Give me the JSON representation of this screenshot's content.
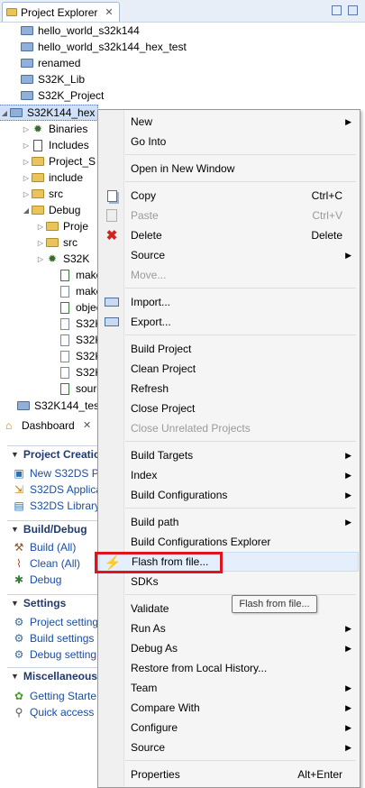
{
  "project_explorer": {
    "tab_title": "Project Explorer",
    "tree": [
      {
        "label": "hello_world_s32k144",
        "kind": "project",
        "arrow": ""
      },
      {
        "label": "hello_world_s32k144_hex_test",
        "kind": "project",
        "arrow": ""
      },
      {
        "label": "renamed",
        "kind": "project",
        "arrow": ""
      },
      {
        "label": "S32K_Lib",
        "kind": "project",
        "arrow": ""
      },
      {
        "label": "S32K_Project",
        "kind": "project",
        "arrow": ""
      },
      {
        "label": "S32K144_hex",
        "kind": "project-open",
        "arrow": "◢"
      },
      {
        "label": "Binaries",
        "kind": "gear",
        "arrow": "▷"
      },
      {
        "label": "Includes",
        "kind": "includes",
        "arrow": "▷"
      },
      {
        "label": "Project_S",
        "kind": "folder",
        "arrow": "▷"
      },
      {
        "label": "include",
        "kind": "folder",
        "arrow": "▷"
      },
      {
        "label": "src",
        "kind": "folder",
        "arrow": "▷"
      },
      {
        "label": "Debug",
        "kind": "folder",
        "arrow": "◢"
      },
      {
        "label": "Proje",
        "kind": "folder",
        "arrow": "▷"
      },
      {
        "label": "src",
        "kind": "folder",
        "arrow": "▷"
      },
      {
        "label": "S32K",
        "kind": "gear",
        "arrow": "▷"
      },
      {
        "label": "make",
        "kind": "file-gear",
        "arrow": ""
      },
      {
        "label": "make",
        "kind": "file",
        "arrow": ""
      },
      {
        "label": "objec",
        "kind": "file-gear",
        "arrow": ""
      },
      {
        "label": "S32K",
        "kind": "file",
        "arrow": ""
      },
      {
        "label": "S32K",
        "kind": "file",
        "arrow": ""
      },
      {
        "label": "S32K",
        "kind": "file",
        "arrow": ""
      },
      {
        "label": "S32K",
        "kind": "file",
        "arrow": ""
      },
      {
        "label": "sourc",
        "kind": "file-gear",
        "arrow": ""
      },
      {
        "label": "S32K144_tes",
        "kind": "project",
        "arrow": ""
      }
    ]
  },
  "dashboard": {
    "tab_title": "Dashboard",
    "sections": [
      {
        "title": "Project Creatio",
        "links": [
          {
            "label": "New S32DS Pr",
            "icon": "new-project-icon"
          },
          {
            "label": "S32DS Applica",
            "icon": "import-icon"
          },
          {
            "label": "S32DS Library",
            "icon": "library-icon"
          }
        ]
      },
      {
        "title": "Build/Debug",
        "links": [
          {
            "label": "Build  (All)",
            "icon": "hammer-icon"
          },
          {
            "label": "Clean  (All)",
            "icon": "broom-icon"
          },
          {
            "label": "Debug",
            "icon": "bug-icon"
          }
        ]
      },
      {
        "title": "Settings",
        "links": [
          {
            "label": "Project setting",
            "icon": "settings-icon"
          },
          {
            "label": "Build settings",
            "icon": "settings-icon"
          },
          {
            "label": "Debug setting",
            "icon": "settings-icon"
          }
        ]
      },
      {
        "title": "Miscellaneous",
        "links": [
          {
            "label": "Getting Starte",
            "icon": "getting-started-icon"
          },
          {
            "label": "Quick access",
            "icon": "quick-access-icon"
          }
        ]
      }
    ]
  },
  "context_menu": {
    "items": [
      {
        "label": "New",
        "shortcut": "",
        "sub": true,
        "disabled": false,
        "icon": ""
      },
      {
        "label": "Go Into",
        "shortcut": "",
        "sub": false,
        "disabled": false,
        "icon": ""
      },
      {
        "sep": true
      },
      {
        "label": "Open in New Window",
        "shortcut": "",
        "sub": false,
        "disabled": false,
        "icon": ""
      },
      {
        "sep": true
      },
      {
        "label": "Copy",
        "shortcut": "Ctrl+C",
        "sub": false,
        "disabled": false,
        "icon": "copy-icon"
      },
      {
        "label": "Paste",
        "shortcut": "Ctrl+V",
        "sub": false,
        "disabled": true,
        "icon": "paste-icon"
      },
      {
        "label": "Delete",
        "shortcut": "Delete",
        "sub": false,
        "disabled": false,
        "icon": "delete-icon"
      },
      {
        "label": "Source",
        "shortcut": "",
        "sub": true,
        "disabled": false,
        "icon": ""
      },
      {
        "label": "Move...",
        "shortcut": "",
        "sub": false,
        "disabled": true,
        "icon": ""
      },
      {
        "sep": true
      },
      {
        "label": "Import...",
        "shortcut": "",
        "sub": false,
        "disabled": false,
        "icon": "import-icon"
      },
      {
        "label": "Export...",
        "shortcut": "",
        "sub": false,
        "disabled": false,
        "icon": "export-icon"
      },
      {
        "sep": true
      },
      {
        "label": "Build Project",
        "shortcut": "",
        "sub": false,
        "disabled": false,
        "icon": ""
      },
      {
        "label": "Clean Project",
        "shortcut": "",
        "sub": false,
        "disabled": false,
        "icon": ""
      },
      {
        "label": "Refresh",
        "shortcut": "",
        "sub": false,
        "disabled": false,
        "icon": ""
      },
      {
        "label": "Close Project",
        "shortcut": "",
        "sub": false,
        "disabled": false,
        "icon": ""
      },
      {
        "label": "Close Unrelated Projects",
        "shortcut": "",
        "sub": false,
        "disabled": true,
        "icon": ""
      },
      {
        "sep": true
      },
      {
        "label": "Build Targets",
        "shortcut": "",
        "sub": true,
        "disabled": false,
        "icon": ""
      },
      {
        "label": "Index",
        "shortcut": "",
        "sub": true,
        "disabled": false,
        "icon": ""
      },
      {
        "label": "Build Configurations",
        "shortcut": "",
        "sub": true,
        "disabled": false,
        "icon": ""
      },
      {
        "sep": true
      },
      {
        "label": "Build path",
        "shortcut": "",
        "sub": true,
        "disabled": false,
        "icon": ""
      },
      {
        "label": "Build Configurations Explorer",
        "shortcut": "",
        "sub": false,
        "disabled": false,
        "icon": ""
      },
      {
        "label": "Flash from file...",
        "shortcut": "",
        "sub": false,
        "disabled": false,
        "icon": "lightning-icon",
        "hover": true
      },
      {
        "label": "SDKs",
        "shortcut": "",
        "sub": false,
        "disabled": false,
        "icon": ""
      },
      {
        "sep": true
      },
      {
        "label": "Validate",
        "shortcut": "",
        "sub": false,
        "disabled": false,
        "icon": ""
      },
      {
        "label": "Run As",
        "shortcut": "",
        "sub": true,
        "disabled": false,
        "icon": ""
      },
      {
        "label": "Debug As",
        "shortcut": "",
        "sub": true,
        "disabled": false,
        "icon": ""
      },
      {
        "label": "Restore from Local History...",
        "shortcut": "",
        "sub": false,
        "disabled": false,
        "icon": ""
      },
      {
        "label": "Team",
        "shortcut": "",
        "sub": true,
        "disabled": false,
        "icon": ""
      },
      {
        "label": "Compare With",
        "shortcut": "",
        "sub": true,
        "disabled": false,
        "icon": ""
      },
      {
        "label": "Configure",
        "shortcut": "",
        "sub": true,
        "disabled": false,
        "icon": ""
      },
      {
        "label": "Source",
        "shortcut": "",
        "sub": true,
        "disabled": false,
        "icon": ""
      },
      {
        "sep": true
      },
      {
        "label": "Properties",
        "shortcut": "Alt+Enter",
        "sub": false,
        "disabled": false,
        "icon": ""
      }
    ],
    "tooltip": "Flash from file..."
  },
  "colors": {
    "highlight_border": "#e0141e",
    "link": "#1a4da3",
    "section_title": "#1f3a6a"
  }
}
